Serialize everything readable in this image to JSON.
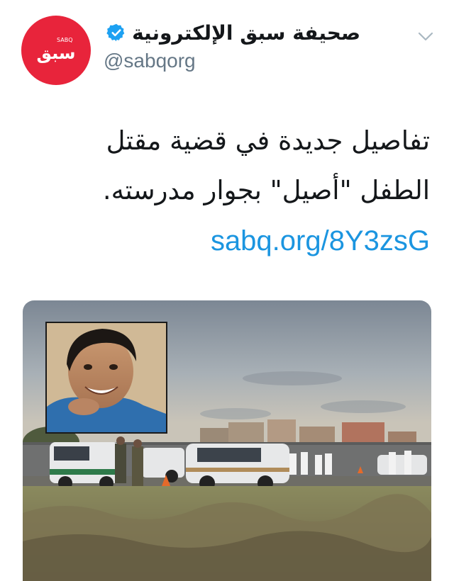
{
  "author": {
    "display_name": "صحيفة سبق الإلكترونية",
    "handle": "@sabqorg",
    "verified": true,
    "avatar": {
      "logo_text": "سبق",
      "logo_small": "SABQ"
    }
  },
  "tweet": {
    "text": "تفاصيل جديدة في قضية مقتل الطفل \"أصيل\" بجوار مدرسته.",
    "link": "sabq.org/8Y3zsG"
  },
  "icons": {
    "menu": "chevron-down-icon",
    "verified": "verified-badge-icon"
  },
  "colors": {
    "avatar_bg": "#e8243b",
    "link": "#1b95e0",
    "verified": "#1da1f2",
    "handle": "#657786"
  }
}
